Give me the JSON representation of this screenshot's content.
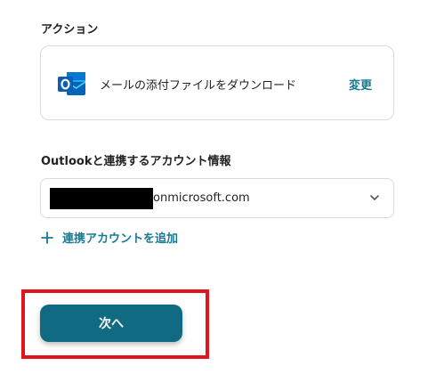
{
  "action": {
    "label": "アクション",
    "name": "メールの添付ファイルをダウンロード",
    "change_label": "変更",
    "app_icon": "outlook-icon"
  },
  "account": {
    "label": "Outlookと連携するアカウント情報",
    "value": "onmicrosoft.com",
    "add_label": "連携アカウントを追加"
  },
  "next_button": {
    "label": "次へ"
  },
  "colors": {
    "accent": "#177a92",
    "button_bg": "#0f6a82",
    "highlight": "#e0141c",
    "border": "#d7dbe0"
  }
}
